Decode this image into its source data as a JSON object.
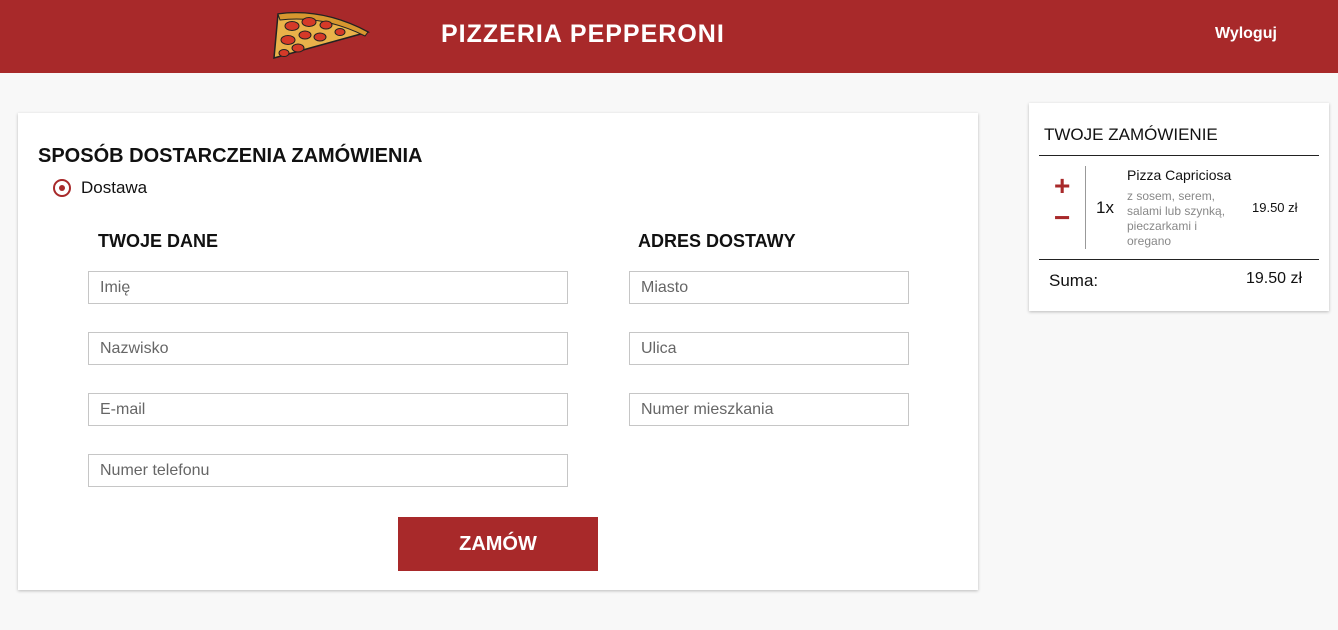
{
  "header": {
    "brand": "PIZZERIA PEPPERONI",
    "logout": "Wyloguj",
    "logo_icon": "pizza-slice-icon"
  },
  "form": {
    "title": "SPOSÓB DOSTARCZENIA ZAMÓWIENIA",
    "delivery_option": "Dostawa",
    "delivery_selected": true,
    "personal": {
      "title": "TWOJE DANE",
      "first_name_placeholder": "Imię",
      "last_name_placeholder": "Nazwisko",
      "email_placeholder": "E-mail",
      "phone_placeholder": "Numer telefonu"
    },
    "address": {
      "title": "ADRES DOSTAWY",
      "city_placeholder": "Miasto",
      "street_placeholder": "Ulica",
      "apartment_placeholder": "Numer mieszkania"
    },
    "submit_label": "ZAMÓW"
  },
  "order": {
    "title": "TWOJE ZAMÓWIENIE",
    "items": [
      {
        "qty": "1x",
        "name": "Pizza Capriciosa",
        "description": "z sosem, serem, salami lub szynką, pieczarkami i oregano",
        "price": "19.50 zł"
      }
    ],
    "sum_label": "Suma:",
    "sum_value": "19.50 zł"
  },
  "colors": {
    "accent": "#a8292a",
    "background": "#f8f8f8",
    "card": "#ffffff"
  }
}
